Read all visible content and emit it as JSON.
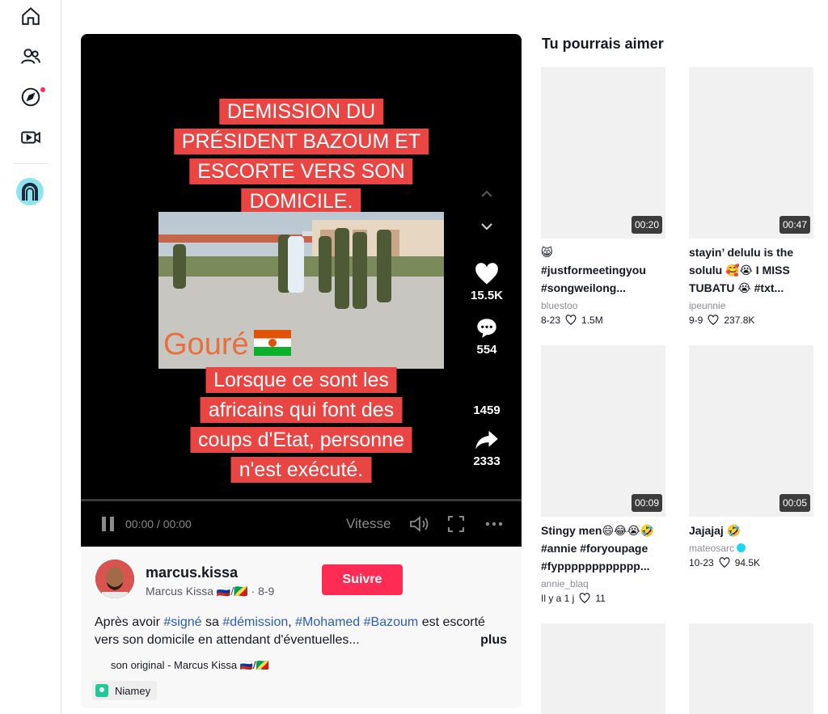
{
  "sidebar": {
    "items": [
      {
        "icon": "home-icon"
      },
      {
        "icon": "following-icon"
      },
      {
        "icon": "explore-icon"
      },
      {
        "icon": "live-icon"
      }
    ]
  },
  "video": {
    "top_text": [
      "DEMISSION DU",
      "PRÉSIDENT BAZOUM ET",
      "ESCORTE VERS SON",
      "DOMICILE."
    ],
    "embed_location": "Gouré",
    "bottom_text": [
      "Lorsque ce sont les",
      "africains qui font des",
      "coups d'Etat, personne",
      "n'est exécuté."
    ],
    "likes": "15.5K",
    "comments": "554",
    "bookmarks": "1459",
    "shares": "2333",
    "time": "00:00 / 00:00",
    "speed_label": "Vitesse"
  },
  "author": {
    "username": "marcus.kissa",
    "display": "Marcus Kissa 🇷🇺/🇨🇬 · 8-9",
    "follow_label": "Suivre"
  },
  "description": {
    "text_1": "Après avoir ",
    "tag_1": "#signé",
    "text_2": " sa ",
    "tag_2": "#démission",
    "text_3": ", ",
    "tag_3": "#Mohamed",
    "text_4": " ",
    "tag_4": "#Bazoum",
    "text_5": " est escorté vers son domicile en attendant d'éventuelles...",
    "more_label": "plus"
  },
  "music": "son original - Marcus Kissa 🇷🇺/🇨🇬",
  "location": "Niamey",
  "suggestions": {
    "title": "Tu pourrais aimer",
    "cards": [
      {
        "duration": "00:20",
        "title": "😸\n#justformeetingyou\n#songweilong...",
        "author": "bluestoo",
        "date": "8-23",
        "likes": "1.5M"
      },
      {
        "duration": "00:47",
        "title": "stayin’ delulu is the\nsolulu 🥰😭 I MISS\nTUBATU 😭 #txt...",
        "author": "ipeunnie",
        "date": "9-9",
        "likes": "237.8K"
      },
      {
        "duration": "00:09",
        "title": "Stingy men😄😂😭🤣\n#annie #foryoupage\n#fypppppppppppp...",
        "author": "annie_blaq",
        "date": "Il y a 1 j",
        "likes": "11"
      },
      {
        "duration": "00:05",
        "title": "Jajajaj 🤣",
        "author": "mateosarc",
        "date": "10-23",
        "likes": "94.5K"
      }
    ]
  }
}
